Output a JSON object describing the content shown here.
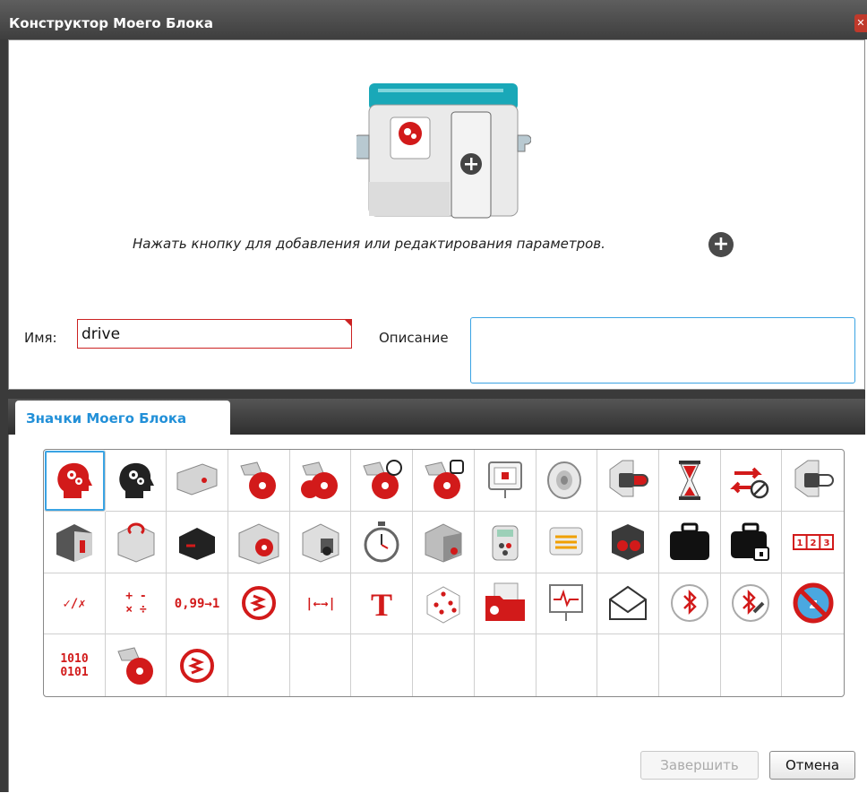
{
  "window": {
    "title": "Конструктор Моего Блока",
    "close_glyph": "✕"
  },
  "editor": {
    "hint": "Нажать кнопку для добавления или редактирования параметров.",
    "name_label": "Имя:",
    "name_value": "drive",
    "description_label": "Описание",
    "description_value": ""
  },
  "tabs": [
    {
      "label": "Значки Моего Блока",
      "active": true
    }
  ],
  "icons": [
    {
      "name": "head-gears-red",
      "selected": true
    },
    {
      "name": "head-gears-black"
    },
    {
      "name": "medium-motor"
    },
    {
      "name": "large-motor"
    },
    {
      "name": "move-tank"
    },
    {
      "name": "move-steering"
    },
    {
      "name": "motor-settings"
    },
    {
      "name": "display"
    },
    {
      "name": "sound"
    },
    {
      "name": "brick-buttons"
    },
    {
      "name": "wait-hourglass"
    },
    {
      "name": "loop-interrupt"
    },
    {
      "name": "brick-status"
    },
    {
      "name": "color-sensor"
    },
    {
      "name": "gyro-sensor"
    },
    {
      "name": "infrared-sensor"
    },
    {
      "name": "motor-rotation"
    },
    {
      "name": "touch-sensor"
    },
    {
      "name": "timer"
    },
    {
      "name": "ultrasonic-sensor"
    },
    {
      "name": "infrared-beacon"
    },
    {
      "name": "energy-meter"
    },
    {
      "name": "temperature-sensor"
    },
    {
      "name": "nxt-case"
    },
    {
      "name": "locked-case"
    },
    {
      "name": "array",
      "text": "1|2|3"
    },
    {
      "name": "logic",
      "text": "✓/✗"
    },
    {
      "name": "math",
      "text": "+ -\n× ÷"
    },
    {
      "name": "round",
      "text": "0,99→1"
    },
    {
      "name": "range-wave"
    },
    {
      "name": "compare-range",
      "text": "|←→|"
    },
    {
      "name": "text",
      "text": "T"
    },
    {
      "name": "random-dice"
    },
    {
      "name": "file-access"
    },
    {
      "name": "data-logging"
    },
    {
      "name": "messaging"
    },
    {
      "name": "bluetooth"
    },
    {
      "name": "bluetooth-settings"
    },
    {
      "name": "no-sleep"
    },
    {
      "name": "binary",
      "text": "1010\n0101"
    },
    {
      "name": "unregulated-motor"
    },
    {
      "name": "range-wave-2"
    }
  ],
  "icon_cells_total": 52,
  "buttons": {
    "finish": "Завершить",
    "cancel": "Отмена"
  },
  "colors": {
    "accent": "#2290d8",
    "brand_red": "#d21a1a",
    "title_bg": "#3e3e3e"
  }
}
